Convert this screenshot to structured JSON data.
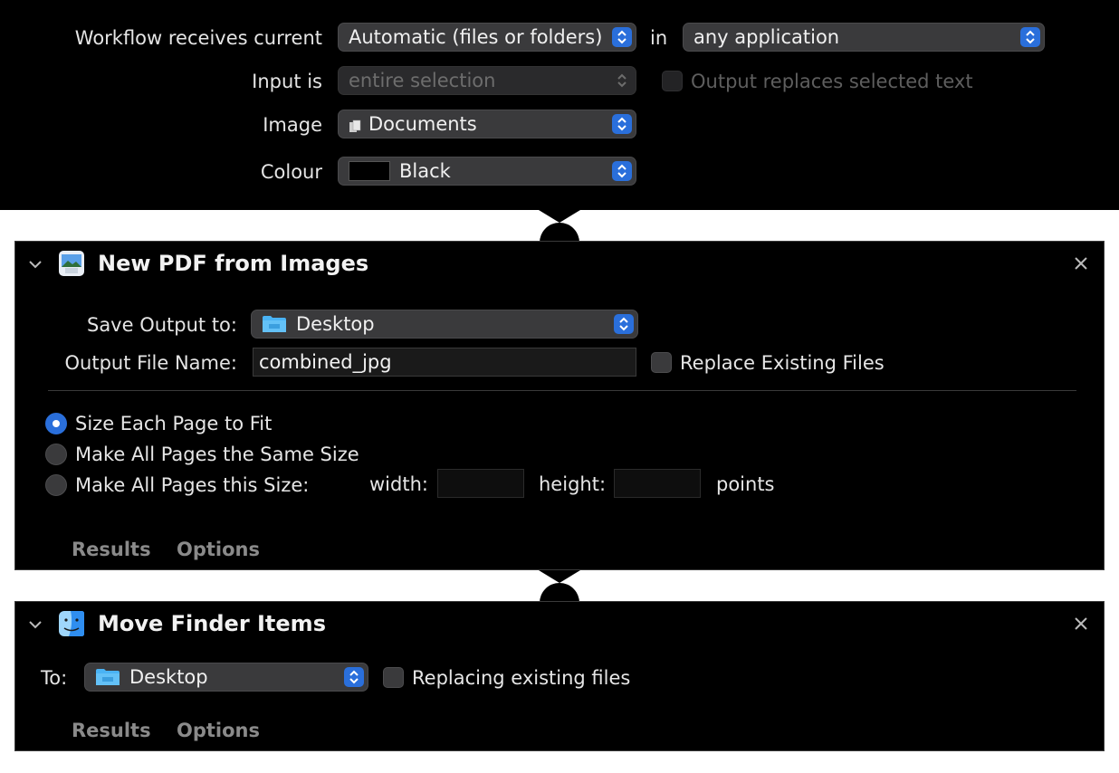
{
  "header": {
    "receives_label": "Workflow receives current",
    "receives_value": "Automatic (files or folders)",
    "in_label": "in",
    "application_value": "any application",
    "input_label": "Input is",
    "input_value": "entire selection",
    "output_replaces_label": "Output replaces selected text",
    "image_label": "Image",
    "image_value": "Documents",
    "colour_label": "Colour",
    "colour_value": "Black",
    "colour_swatch": "#000000"
  },
  "pdf_action": {
    "title": "New PDF from Images",
    "save_output_label": "Save Output to:",
    "save_output_value": "Desktop",
    "file_name_label": "Output File Name:",
    "file_name_value": "combined_jpg",
    "replace_label": "Replace Existing Files",
    "radio_options": [
      "Size Each Page to Fit",
      "Make All Pages the Same Size",
      "Make All Pages this Size:"
    ],
    "selected_option": "Size Each Page to Fit",
    "width_label": "width:",
    "height_label": "height:",
    "points_label": "points",
    "results_label": "Results",
    "options_label": "Options"
  },
  "move_action": {
    "title": "Move Finder Items",
    "to_label": "To:",
    "to_value": "Desktop",
    "replacing_label": "Replacing existing files",
    "results_label": "Results",
    "options_label": "Options"
  },
  "colors": {
    "accent": "#2a6fdb",
    "folder": "#4ab3f4"
  }
}
